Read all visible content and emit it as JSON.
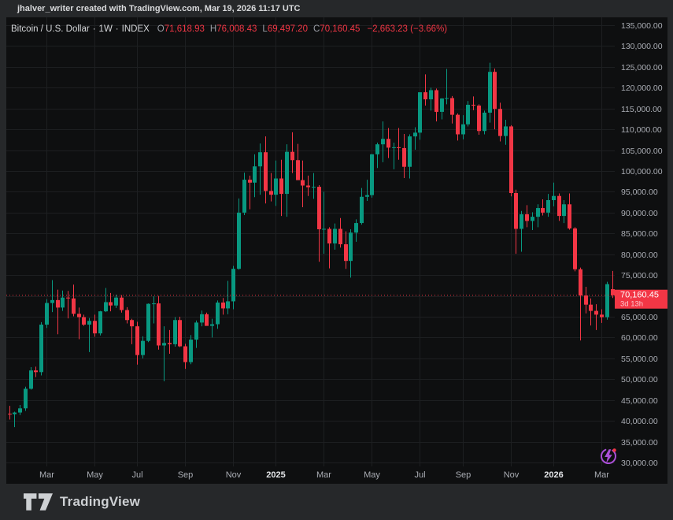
{
  "header": {
    "attribution": "jhalver_writer created with TradingView.com, Mar 19, 2026 11:17 UTC"
  },
  "legend": {
    "symbol": "Bitcoin / U.S. Dollar",
    "separator": "·",
    "interval": "1W",
    "exchange": "INDEX",
    "open_label": "O",
    "open": "71,618.93",
    "high_label": "H",
    "high": "76,008.43",
    "low_label": "L",
    "low": "69,497.20",
    "close_label": "C",
    "close": "70,160.45",
    "change": "−2,663.23 (−3.66%)"
  },
  "price_scale": {
    "last_price_label": "70,160.45",
    "countdown": "3d 13h"
  },
  "footer": {
    "brand": "TradingView"
  },
  "colors": {
    "frame_bg": "#26282a",
    "panel_bg": "#0e0f10",
    "grid": "#1d1f21",
    "up": "#089981",
    "down": "#f23645",
    "axis_text": "#aaadb4",
    "axis_text_bold": "#e4e6e9",
    "label_bg": "#f23645",
    "label_text": "#ffffff",
    "purple": "#aa4fd6"
  },
  "chart_data": {
    "type": "candlestick",
    "title": "Bitcoin / U.S. Dollar",
    "interval": "1W",
    "exchange": "INDEX",
    "legend_position": "top-left",
    "grid": true,
    "y_axis": {
      "min": 30000,
      "max": 135000,
      "step": 5000
    },
    "y_tick_values": [
      135000,
      130000,
      125000,
      120000,
      115000,
      110000,
      105000,
      100000,
      95000,
      90000,
      85000,
      80000,
      75000,
      70000,
      65000,
      60000,
      55000,
      50000,
      45000,
      40000,
      35000,
      30000
    ],
    "x_axis_labels": [
      {
        "label": "Mar",
        "index": 7,
        "bold": false
      },
      {
        "label": "May",
        "index": 16,
        "bold": false
      },
      {
        "label": "Jul",
        "index": 24,
        "bold": false
      },
      {
        "label": "Sep",
        "index": 33,
        "bold": false
      },
      {
        "label": "Nov",
        "index": 42,
        "bold": false
      },
      {
        "label": "2025",
        "index": 50,
        "bold": true
      },
      {
        "label": "Mar",
        "index": 59,
        "bold": false
      },
      {
        "label": "May",
        "index": 68,
        "bold": false
      },
      {
        "label": "Jul",
        "index": 77,
        "bold": false
      },
      {
        "label": "Sep",
        "index": 85,
        "bold": false
      },
      {
        "label": "Nov",
        "index": 94,
        "bold": false
      },
      {
        "label": "2026",
        "index": 102,
        "bold": true
      },
      {
        "label": "Mar",
        "index": 111,
        "bold": false
      }
    ],
    "current_price": 70160.45,
    "countdown": "3d 13h",
    "last_candle": {
      "open": 71618.93,
      "high": 76008.43,
      "low": 69497.2,
      "close": 70160.45,
      "change": -2663.23,
      "change_pct": -3.66
    },
    "candles": [
      [
        41700,
        43600,
        40300,
        41600
      ],
      [
        41600,
        42200,
        38500,
        42000
      ],
      [
        42000,
        43800,
        41400,
        43000
      ],
      [
        43000,
        48200,
        42400,
        47700
      ],
      [
        47700,
        52900,
        47500,
        52100
      ],
      [
        52100,
        53000,
        50500,
        51700
      ],
      [
        51700,
        63700,
        50900,
        63100
      ],
      [
        63100,
        69200,
        62300,
        68300
      ],
      [
        68300,
        73800,
        66100,
        69000
      ],
      [
        69000,
        71500,
        60800,
        67200
      ],
      [
        67200,
        71300,
        66400,
        69600
      ],
      [
        69600,
        71200,
        64600,
        69400
      ],
      [
        69400,
        72700,
        65100,
        65700
      ],
      [
        65700,
        67200,
        59600,
        64900
      ],
      [
        64900,
        65500,
        62800,
        63100
      ],
      [
        63100,
        64700,
        56500,
        64000
      ],
      [
        64000,
        65500,
        60200,
        61000
      ],
      [
        61000,
        66400,
        60500,
        66300
      ],
      [
        66300,
        71900,
        66100,
        68500
      ],
      [
        68500,
        70700,
        66300,
        67700
      ],
      [
        67700,
        70300,
        67100,
        69600
      ],
      [
        69600,
        70200,
        66000,
        66600
      ],
      [
        66600,
        67300,
        63400,
        64200
      ],
      [
        64200,
        64500,
        58400,
        62700
      ],
      [
        62700,
        63800,
        53500,
        55800
      ],
      [
        55800,
        60300,
        55000,
        59200
      ],
      [
        59200,
        68200,
        58900,
        68100
      ],
      [
        68100,
        69900,
        63400,
        68200
      ],
      [
        68200,
        70000,
        57100,
        58100
      ],
      [
        58100,
        62700,
        49500,
        58700
      ],
      [
        58700,
        61800,
        56100,
        58400
      ],
      [
        58400,
        64900,
        57800,
        64200
      ],
      [
        64200,
        65000,
        57700,
        57900
      ],
      [
        57900,
        58500,
        52500,
        54100
      ],
      [
        54100,
        60600,
        53600,
        59500
      ],
      [
        59500,
        64100,
        57500,
        63600
      ],
      [
        63600,
        66500,
        62700,
        65600
      ],
      [
        65600,
        66000,
        62900,
        62800
      ],
      [
        62800,
        64500,
        60000,
        63200
      ],
      [
        63200,
        68900,
        62100,
        68400
      ],
      [
        68400,
        69500,
        65500,
        67000
      ],
      [
        67000,
        73600,
        65600,
        68700
      ],
      [
        68700,
        77200,
        66800,
        76500
      ],
      [
        76500,
        93400,
        76300,
        90000
      ],
      [
        90000,
        99600,
        89400,
        97900
      ],
      [
        97900,
        98900,
        90800,
        97200
      ],
      [
        97200,
        104000,
        93700,
        101100
      ],
      [
        101100,
        106600,
        94300,
        104500
      ],
      [
        104500,
        108300,
        92200,
        95200
      ],
      [
        95200,
        99500,
        92700,
        94300
      ],
      [
        94300,
        102500,
        91600,
        98200
      ],
      [
        98200,
        102700,
        89200,
        94500
      ],
      [
        94500,
        106400,
        89000,
        104600
      ],
      [
        104600,
        109300,
        99500,
        102600
      ],
      [
        102600,
        106500,
        97800,
        97800
      ],
      [
        97800,
        102500,
        91300,
        96500
      ],
      [
        96500,
        98900,
        94000,
        96100
      ],
      [
        96100,
        99500,
        93300,
        96200
      ],
      [
        96200,
        96600,
        78200,
        86000
      ],
      [
        86000,
        95000,
        80100,
        86100
      ],
      [
        86100,
        86500,
        76600,
        82600
      ],
      [
        82600,
        87400,
        81100,
        86100
      ],
      [
        86100,
        88700,
        81600,
        82400
      ],
      [
        82400,
        85500,
        76500,
        78400
      ],
      [
        78400,
        86000,
        74400,
        85200
      ],
      [
        85200,
        88400,
        83000,
        87500
      ],
      [
        87500,
        95900,
        87100,
        93800
      ],
      [
        93800,
        97900,
        92800,
        94200
      ],
      [
        94200,
        104100,
        93600,
        104000
      ],
      [
        104000,
        106800,
        100700,
        106400
      ],
      [
        106400,
        111900,
        102100,
        107700
      ],
      [
        107700,
        110300,
        103100,
        105600
      ],
      [
        105600,
        106800,
        100400,
        105700
      ],
      [
        105700,
        110300,
        102700,
        105500
      ],
      [
        105500,
        108900,
        98300,
        101000
      ],
      [
        101000,
        108800,
        98200,
        108300
      ],
      [
        108300,
        110500,
        105100,
        109200
      ],
      [
        109200,
        118900,
        107500,
        118900
      ],
      [
        118900,
        123200,
        115700,
        117200
      ],
      [
        117200,
        120000,
        114500,
        119400
      ],
      [
        119400,
        119800,
        111900,
        114200
      ],
      [
        114200,
        117500,
        112400,
        117400
      ],
      [
        117400,
        124500,
        116000,
        117500
      ],
      [
        117500,
        118000,
        111400,
        113500
      ],
      [
        113500,
        113800,
        107300,
        108800
      ],
      [
        108800,
        113400,
        107600,
        111200
      ],
      [
        111200,
        116800,
        110700,
        115900
      ],
      [
        115900,
        117900,
        114600,
        115700
      ],
      [
        115700,
        116000,
        108700,
        109600
      ],
      [
        109600,
        114500,
        108800,
        114000
      ],
      [
        114000,
        126000,
        111600,
        123800
      ],
      [
        123800,
        124600,
        110000,
        114900
      ],
      [
        114900,
        116400,
        107100,
        108400
      ],
      [
        108400,
        112300,
        106300,
        110700
      ],
      [
        110700,
        111000,
        93900,
        94700
      ],
      [
        94700,
        95500,
        80100,
        86100
      ],
      [
        86100,
        90400,
        80600,
        89600
      ],
      [
        89600,
        91800,
        86500,
        88000
      ],
      [
        88000,
        90100,
        85800,
        89000
      ],
      [
        89000,
        92000,
        86500,
        91100
      ],
      [
        91100,
        93200,
        89300,
        90000
      ],
      [
        90000,
        94500,
        89000,
        93000
      ],
      [
        93000,
        97200,
        91500,
        94000
      ],
      [
        94000,
        94600,
        88000,
        89200
      ],
      [
        89200,
        93000,
        87500,
        92000
      ],
      [
        92000,
        94600,
        85900,
        86200
      ],
      [
        86200,
        86500,
        75900,
        76400
      ],
      [
        76400,
        76800,
        59300,
        70100
      ],
      [
        70100,
        72200,
        65800,
        67900
      ],
      [
        67900,
        69400,
        62900,
        66400
      ],
      [
        66400,
        68000,
        61800,
        65500
      ],
      [
        65500,
        66800,
        63500,
        64900
      ],
      [
        64900,
        73400,
        64300,
        72823.68
      ],
      [
        71618.93,
        76008.43,
        69497.2,
        70160.45
      ]
    ]
  }
}
